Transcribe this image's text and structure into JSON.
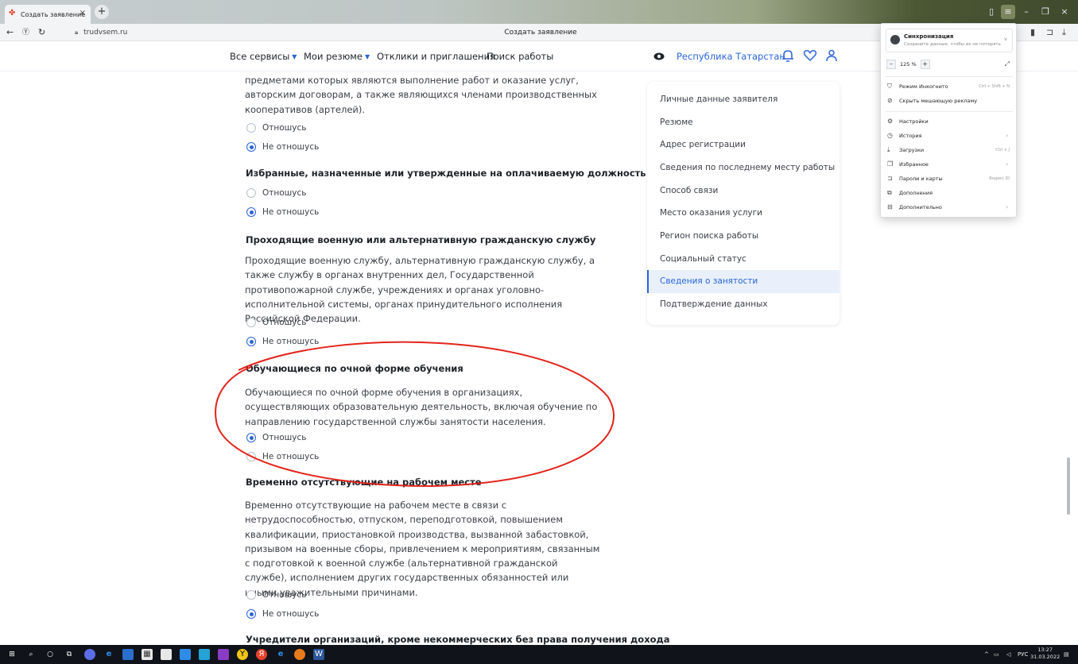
{
  "browser": {
    "tab_title": "Создать заявление",
    "url": "trudvsem.ru",
    "page_title": "Создать заявление"
  },
  "header": {
    "nav": [
      {
        "label": "Все сервисы",
        "dropdown": true
      },
      {
        "label": "Мои резюме",
        "dropdown": true
      },
      {
        "label": "Отклики и приглашения",
        "dropdown": false
      },
      {
        "label": "Поиск работы",
        "dropdown": false
      }
    ],
    "region": "Республика Татарстан"
  },
  "main": {
    "intro_text": "предметами которых являются выполнение работ и оказание услуг, авторским договорам, а также являющихся членами производственных кооперативов (артелей).",
    "sections": [
      {
        "heading": "",
        "description": "",
        "options": [
          {
            "label": "Отношусь",
            "checked": false
          },
          {
            "label": "Не отношусь",
            "checked": true
          }
        ]
      },
      {
        "heading": "Избранные, назначенные или утвержденные на оплачиваемую должность",
        "description": "",
        "options": [
          {
            "label": "Отношусь",
            "checked": false
          },
          {
            "label": "Не отношусь",
            "checked": true
          }
        ]
      },
      {
        "heading": "Проходящие военную или альтернативную гражданскую службу",
        "description": "Проходящие военную службу, альтернативную гражданскую службу, а также службу в органах внутренних дел, Государственной противопожарной службе, учреждениях и органах уголовно-исполнительной системы, органах принудительного исполнения Российской Федерации.",
        "options": [
          {
            "label": "Отношусь",
            "checked": false
          },
          {
            "label": "Не отношусь",
            "checked": true
          }
        ]
      },
      {
        "heading": "Обучающиеся по очной форме обучения",
        "description": "Обучающиеся по очной форме обучения в организациях, осуществляющих образовательную деятельность, включая обучение по направлению государственной службы занятости населения.",
        "options": [
          {
            "label": "Отношусь",
            "checked": true
          },
          {
            "label": "Не отношусь",
            "checked": false
          }
        ]
      },
      {
        "heading": "Временно отсутствующие на рабочем месте",
        "description": "Временно отсутствующие на рабочем месте в связи с нетрудоспособностью, отпуском, переподготовкой, повышением квалификации, приостановкой производства, вызванной забастовкой, призывом на военные сборы, привлечением к мероприятиям, связанным с подготовкой к военной службе (альтернативной гражданской службе), исполнением других государственных обязанностей или иными уважительными причинами.",
        "options": [
          {
            "label": "Отношусь",
            "checked": false
          },
          {
            "label": "Не отношусь",
            "checked": true
          }
        ]
      },
      {
        "heading": "Учредители организаций, кроме некоммерческих без права получения дохода",
        "description": "",
        "options": []
      }
    ]
  },
  "side_menu": {
    "items": [
      {
        "label": "Личные данные заявителя",
        "active": false
      },
      {
        "label": "Резюме",
        "active": false
      },
      {
        "label": "Адрес регистрации",
        "active": false
      },
      {
        "label": "Сведения по последнему месту работы",
        "active": false
      },
      {
        "label": "Способ связи",
        "active": false
      },
      {
        "label": "Место оказания услуги",
        "active": false
      },
      {
        "label": "Регион поиска работы",
        "active": false
      },
      {
        "label": "Социальный статус",
        "active": false
      },
      {
        "label": "Сведения о занятости",
        "active": true
      },
      {
        "label": "Подтверждение данных",
        "active": false
      }
    ]
  },
  "browser_menu": {
    "sync_title": "Синхронизация",
    "sync_subtitle": "Сохраните данные, чтобы их не потерять",
    "zoom": "125 %",
    "items": [
      {
        "label": "Режим Инкогнито",
        "shortcut": "Ctrl + Shift + N",
        "icon": "incognito-icon",
        "arrow": false
      },
      {
        "label": "Скрыть мешающую рекламу",
        "shortcut": "",
        "icon": "block-icon",
        "arrow": false
      },
      {
        "label": "Настройки",
        "shortcut": "",
        "icon": "gear-icon",
        "arrow": false
      },
      {
        "label": "История",
        "shortcut": "",
        "icon": "clock-icon",
        "arrow": true
      },
      {
        "label": "Загрузки",
        "shortcut": "Ctrl + J",
        "icon": "download-icon",
        "arrow": false
      },
      {
        "label": "Избранное",
        "shortcut": "",
        "icon": "bookmark-icon",
        "arrow": true
      },
      {
        "label": "Пароли и карты",
        "shortcut": "Яндекс ID",
        "icon": "key-icon",
        "arrow": false
      },
      {
        "label": "Дополнения",
        "shortcut": "",
        "icon": "puzzle-icon",
        "arrow": false
      },
      {
        "label": "Дополнительно",
        "shortcut": "",
        "icon": "more-icon",
        "arrow": true
      }
    ]
  },
  "taskbar": {
    "lang": "РУС",
    "time": "13:27",
    "date": "31.03.2022"
  },
  "colors": {
    "accent": "#2a64d8",
    "annotation": "#e3231b"
  }
}
